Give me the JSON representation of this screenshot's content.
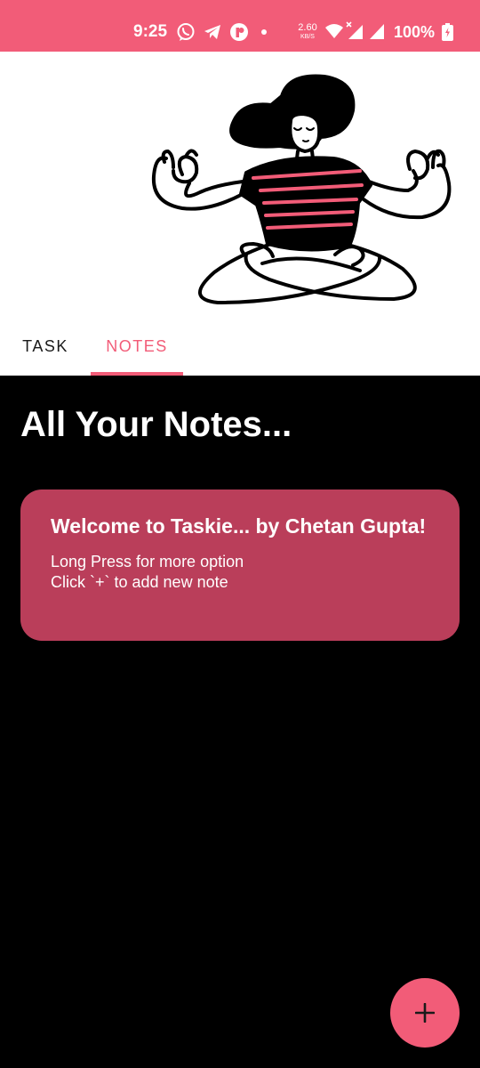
{
  "status_bar": {
    "time": "9:25",
    "network_speed_value": "2.60",
    "network_speed_unit": "KB/S",
    "battery": "100%",
    "icons": [
      "whatsapp-icon",
      "telegram-icon",
      "app-notification-icon",
      "dot-icon",
      "wifi-icon",
      "cellular-signal-x-icon",
      "cellular-signal-icon",
      "battery-charging-icon"
    ]
  },
  "header": {
    "illustration": "meditating-woman-illustration"
  },
  "tabs": [
    {
      "label": "TASK",
      "selected": false
    },
    {
      "label": "NOTES",
      "selected": true
    }
  ],
  "main": {
    "title": "All Your Notes...",
    "notes": [
      {
        "title": "Welcome to Taskie... by Chetan Gupta!",
        "body": "Long Press for more option\nClick `+` to add new note"
      }
    ]
  },
  "fab": {
    "icon": "plus-icon"
  },
  "colors": {
    "accent": "#f25c78",
    "card": "#ba3e5a",
    "background": "#000000",
    "header_background": "#ffffff"
  }
}
